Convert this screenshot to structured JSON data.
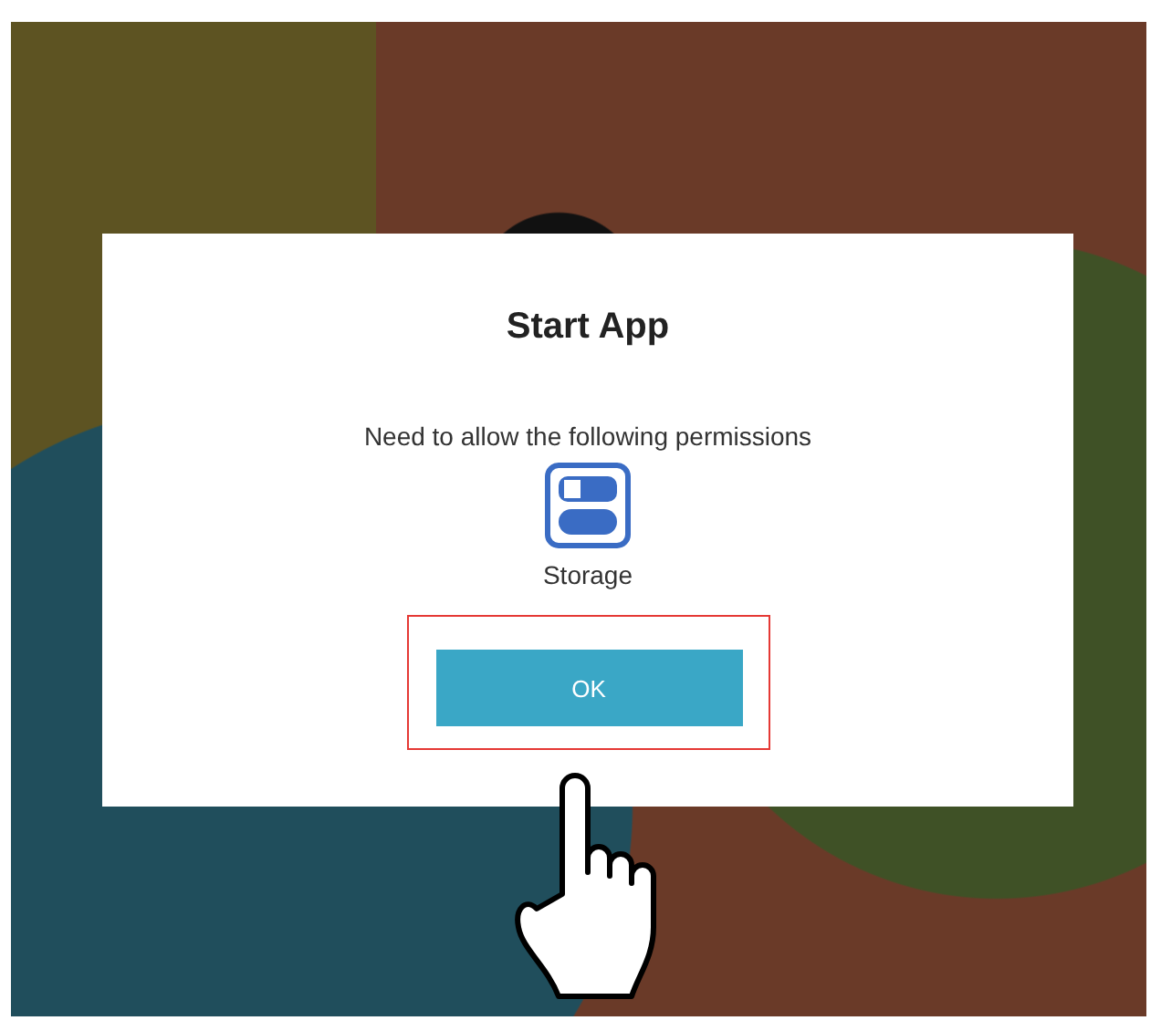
{
  "dialog": {
    "title": "Start App",
    "message": "Need to allow the following permissions",
    "permissions": [
      {
        "label": "Storage"
      }
    ],
    "button": "OK"
  }
}
